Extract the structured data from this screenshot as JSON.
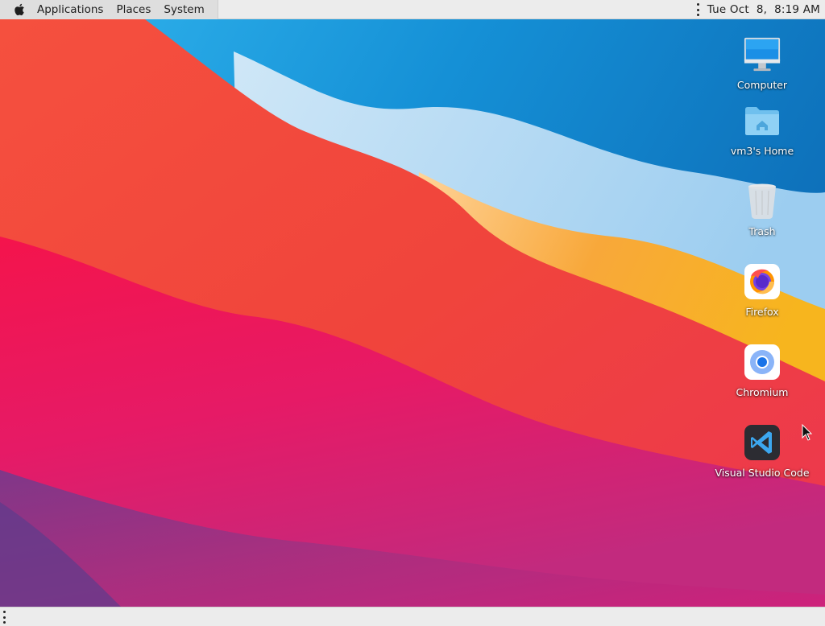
{
  "top_panel": {
    "menus": [
      {
        "label": "Applications"
      },
      {
        "label": "Places"
      },
      {
        "label": "System"
      }
    ],
    "clock": "Tue Oct  8,  8:19 AM",
    "logo_icon": "apple-icon",
    "overflow_icon": "vertical-dots-icon"
  },
  "desktop_icons": [
    {
      "label": "Computer",
      "icon": "computer-icon"
    },
    {
      "label": "vm3's Home",
      "icon": "home-folder-icon"
    },
    {
      "label": "Trash",
      "icon": "trash-icon"
    },
    {
      "label": "Firefox",
      "icon": "firefox-icon"
    },
    {
      "label": "Chromium",
      "icon": "chromium-icon"
    },
    {
      "label": "Visual Studio Code",
      "icon": "vscode-icon"
    }
  ],
  "bottom_panel": {
    "overflow_icon": "vertical-dots-icon"
  },
  "wallpaper": {
    "colors": [
      "#1a9be0",
      "#f04a3a",
      "#f5a623",
      "#e8145a",
      "#7a3a8a"
    ]
  }
}
